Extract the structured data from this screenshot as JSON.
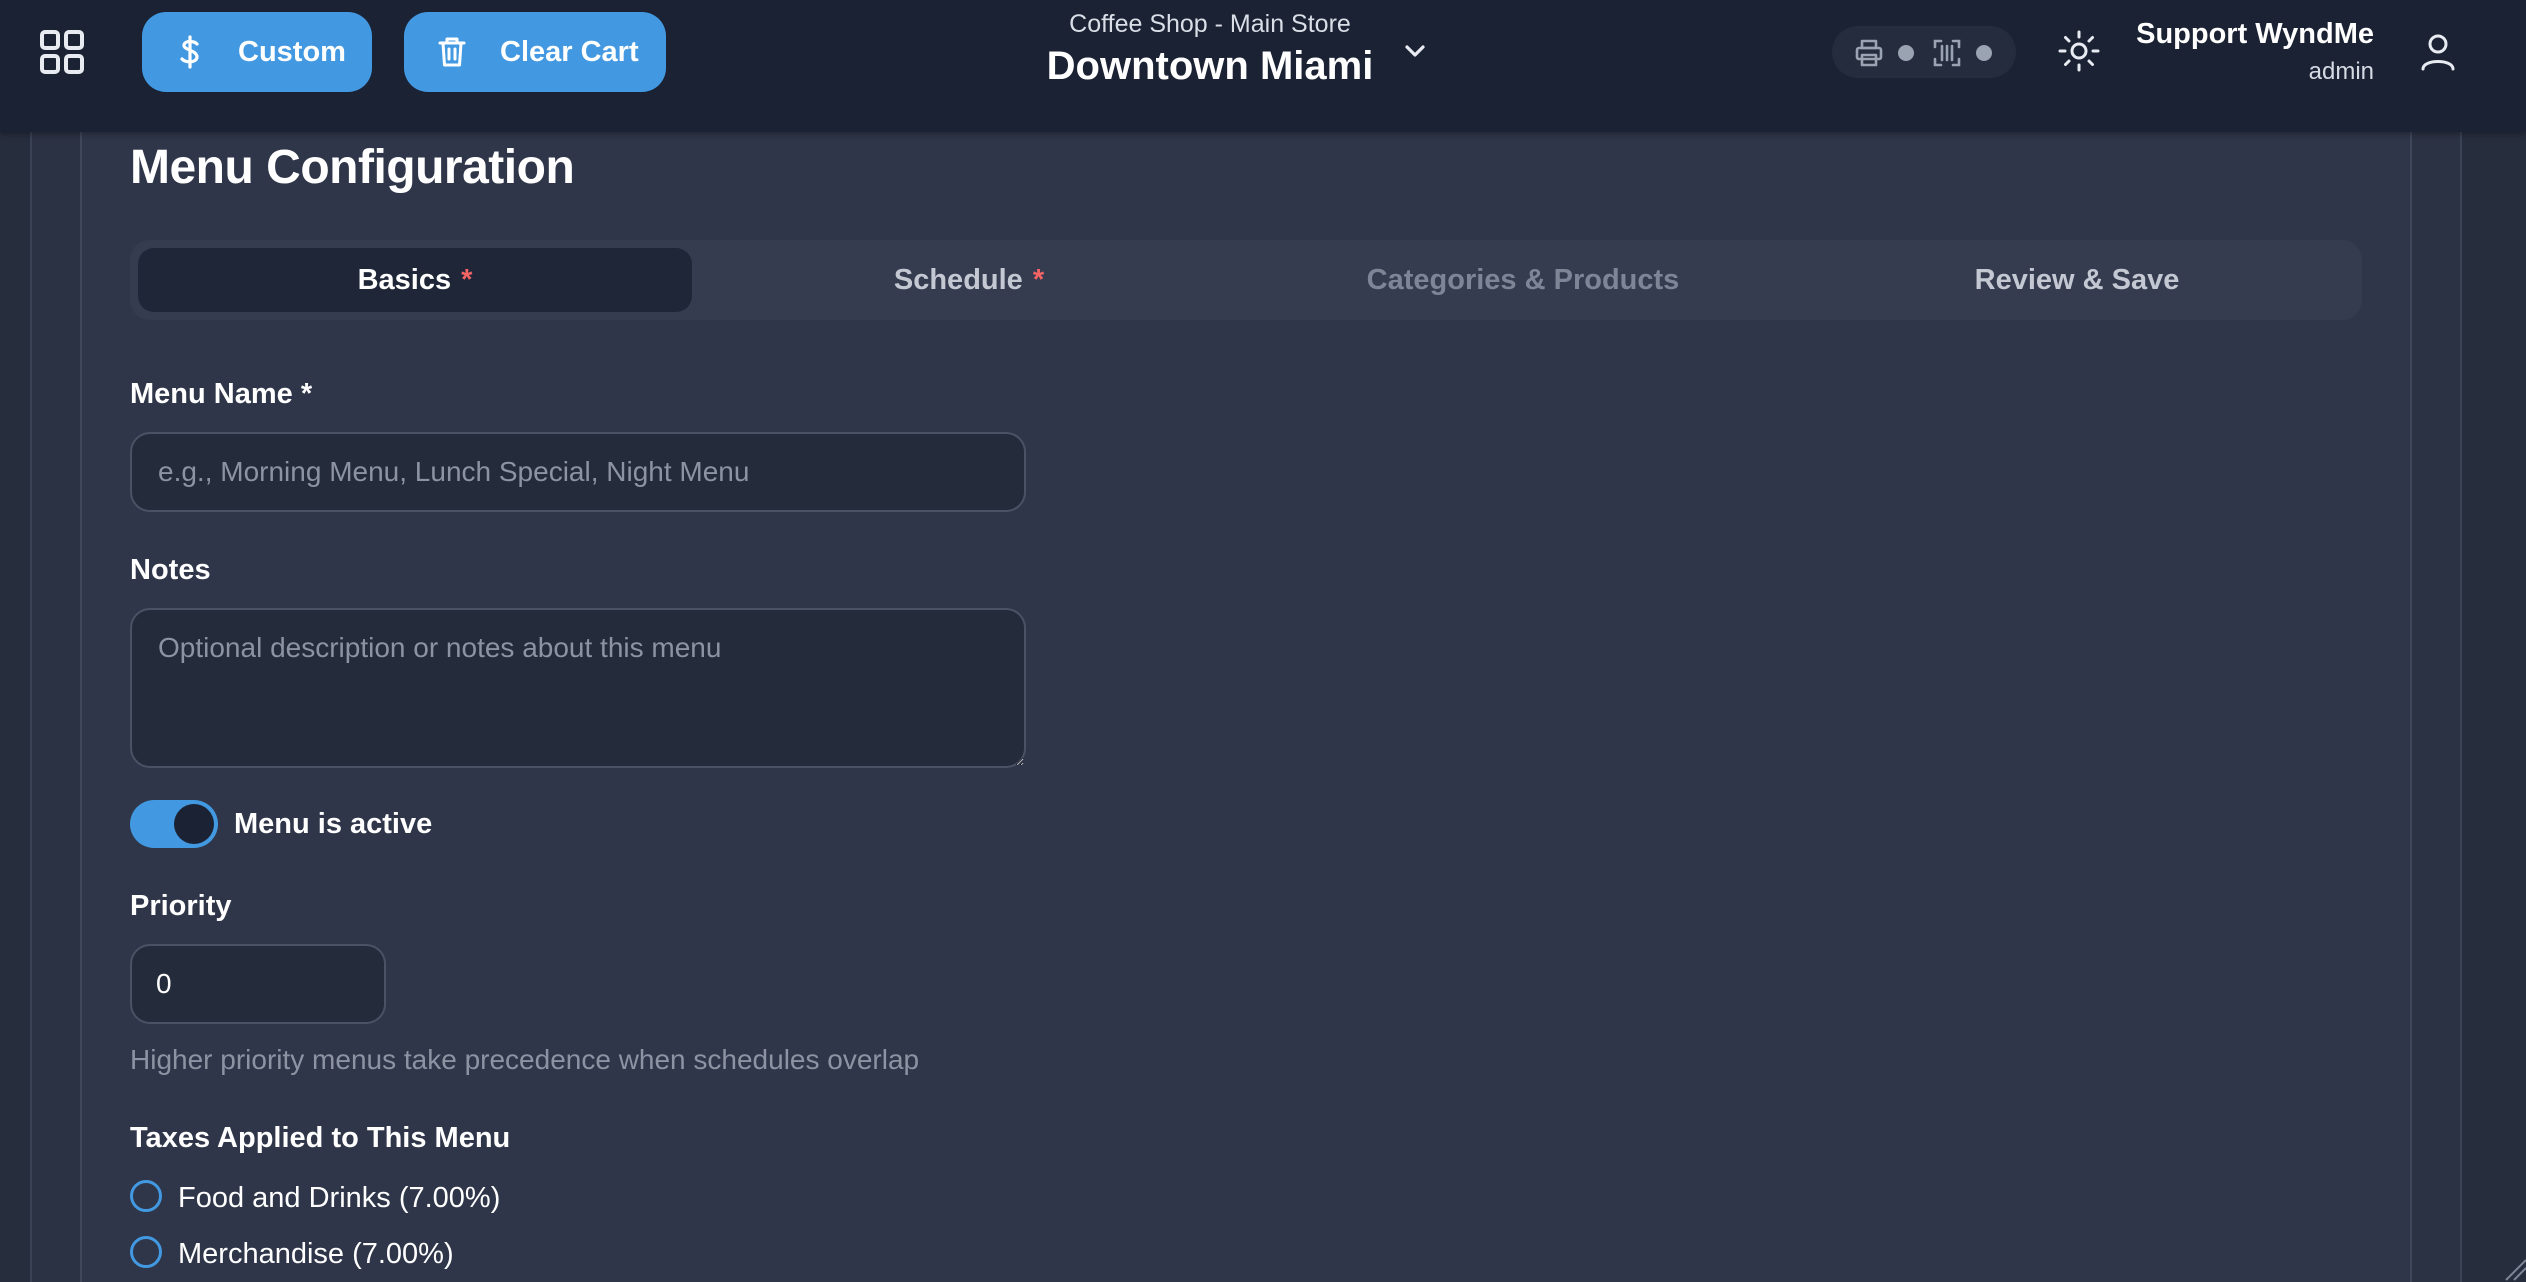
{
  "header": {
    "custom_button": "Custom",
    "clear_cart_button": "Clear Cart",
    "store_subtitle": "Coffee Shop - Main Store",
    "store_name": "Downtown Miami",
    "user_name": "Support WyndMe",
    "user_role": "admin",
    "accent_color": "#4299e1"
  },
  "page": {
    "title": "Menu Configuration"
  },
  "tabs": [
    {
      "label": "Basics",
      "required": "*",
      "state": "active"
    },
    {
      "label": "Schedule",
      "required": "*",
      "state": "normal"
    },
    {
      "label": "Categories & Products",
      "required": "",
      "state": "disabled"
    },
    {
      "label": "Review & Save",
      "required": "",
      "state": "normal"
    }
  ],
  "form": {
    "menu_name_label": "Menu Name *",
    "menu_name_placeholder": "e.g., Morning Menu, Lunch Special, Night Menu",
    "menu_name_value": "",
    "notes_label": "Notes",
    "notes_placeholder": "Optional description or notes about this menu",
    "notes_value": "",
    "active_label": "Menu is active",
    "active_on": true,
    "priority_label": "Priority",
    "priority_value": "0",
    "priority_hint": "Higher priority menus take precedence when schedules overlap",
    "taxes_label": "Taxes Applied to This Menu",
    "taxes": [
      {
        "label": "Food and Drinks (7.00%)",
        "checked": false
      },
      {
        "label": "Merchandise (7.00%)",
        "checked": false
      }
    ]
  }
}
